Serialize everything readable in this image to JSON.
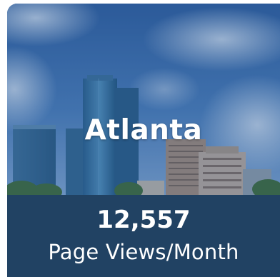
{
  "card": {
    "city": "Atlanta",
    "views_value": "12,557",
    "views_label": "Page Views/Month",
    "image_subject": "atlanta-skyline-photo"
  },
  "colors": {
    "overlay": "#214263",
    "text": "#ffffff",
    "sky": "#3f6fa8"
  }
}
